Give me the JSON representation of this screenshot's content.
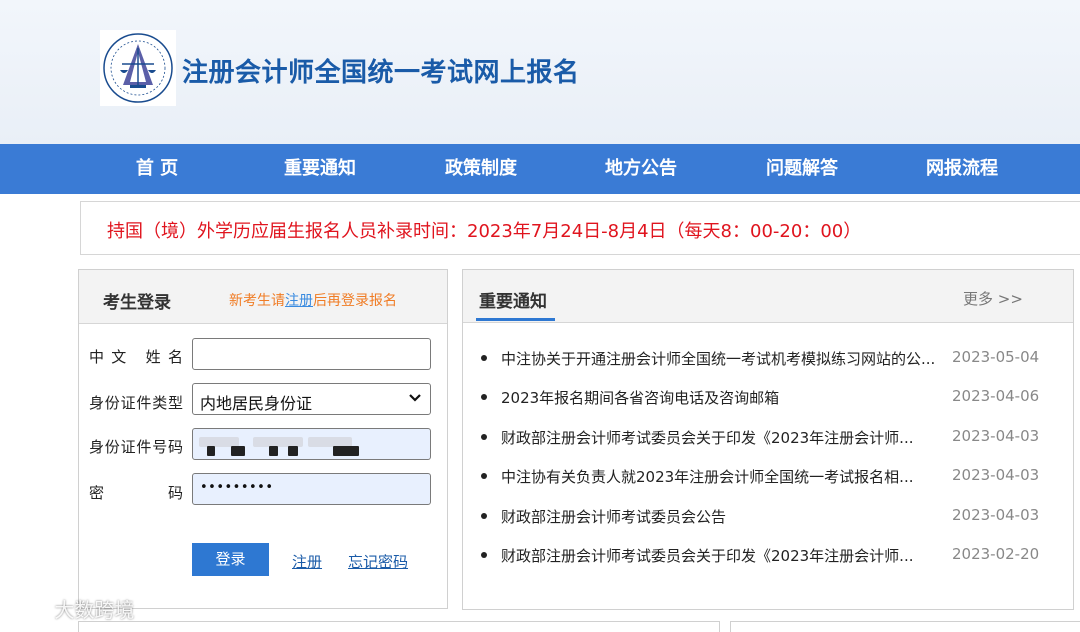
{
  "header": {
    "site_title": "注册会计师全国统一考试网上报名"
  },
  "nav": {
    "items": [
      {
        "label": "首 页"
      },
      {
        "label": "重要通知"
      },
      {
        "label": "政策制度"
      },
      {
        "label": "地方公告"
      },
      {
        "label": "问题解答"
      },
      {
        "label": "网报流程"
      }
    ]
  },
  "notice": {
    "text": "持国（境）外学历应届生报名人员补录时间：2023年7月24日-8月4日（每天8：00-20：00）"
  },
  "login": {
    "title": "考生登录",
    "hint_prefix": "新考生请",
    "hint_link": "注册",
    "hint_suffix": "后再登录报名",
    "name_label": "中文 姓名",
    "name_value": "",
    "id_type_label": "身份证件类型",
    "id_type_value": "内地居民身份证",
    "id_number_label": "身份证件号码",
    "password_label": "密 码",
    "password_value": "•••••••••",
    "login_button": "登录",
    "register_link": "注册",
    "forgot_link": "忘记密码"
  },
  "news": {
    "title": "重要通知",
    "more": "更多 >>",
    "items": [
      {
        "title": "中注协关于开通注册会计师全国统一考试机考模拟练习网站的公...",
        "date": "2023-05-04"
      },
      {
        "title": "2023年报名期间各省咨询电话及咨询邮箱",
        "date": "2023-04-06"
      },
      {
        "title": "财政部注册会计师考试委员会关于印发《2023年注册会计师...",
        "date": "2023-04-03"
      },
      {
        "title": "中注协有关负责人就2023年注册会计师全国统一考试报名相...",
        "date": "2023-04-03"
      },
      {
        "title": "财政部注册会计师考试委员会公告",
        "date": "2023-04-03"
      },
      {
        "title": "财政部注册会计师考试委员会关于印发《2023年注册会计师...",
        "date": "2023-02-20"
      }
    ]
  },
  "watermark": {
    "text": "大数跨境"
  },
  "colors": {
    "brand_blue": "#3a7bd5",
    "title_blue": "#1a5ba8",
    "notice_red": "#e0141e",
    "hint_orange": "#f07c25"
  }
}
